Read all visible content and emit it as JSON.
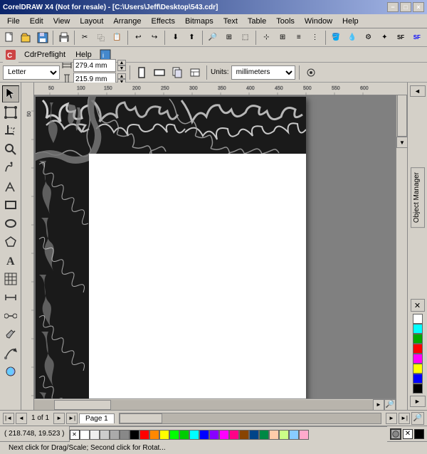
{
  "window": {
    "title": "CorelDRAW X4 (Not for resale) - [C:\\Users\\Jeff\\Desktop\\543.cdr]",
    "title_short": "CorelDRAW X4 (Not for resale) - [C:\\Users\\Jeff\\Desktop\\543.cdr]"
  },
  "title_buttons": {
    "minimize": "−",
    "maximize": "□",
    "close": "×",
    "inner_minimize": "−",
    "inner_maximize": "□",
    "inner_close": "×"
  },
  "menu": {
    "items": [
      "File",
      "Edit",
      "View",
      "Layout",
      "Arrange",
      "Effects",
      "Bitmaps",
      "Text",
      "Table",
      "Tools",
      "Window",
      "Help"
    ]
  },
  "toolbar2": {
    "preflight": "CdrPreflight",
    "help": "Help"
  },
  "prop_bar": {
    "width_label": "279.4 mm",
    "height_label": "215.9 mm",
    "units_label": "Units:",
    "units_value": "millimeters",
    "page_size": "Letter"
  },
  "tools": {
    "items": [
      "↖",
      "⊹",
      "✂",
      "↔",
      "⬚",
      "○",
      "✏",
      "A",
      "⊞",
      "🔎",
      "✋",
      "⬡",
      "▲",
      "⭕",
      "📐",
      "⌨",
      "🖊",
      "◈",
      "🔧",
      "◐"
    ]
  },
  "canvas": {
    "page_number": "1 of 1",
    "page_name": "Page 1"
  },
  "status": {
    "coords": "( 218.748, 19.523 )",
    "message": "Next click for Drag/Scale; Second click for Rotat..."
  },
  "right_panel": {
    "obj_manager": "Object Manager"
  },
  "colors": {
    "white": "#FFFFFF",
    "black": "#000000",
    "red": "#FF0000",
    "green": "#00AA00",
    "blue": "#0000FF",
    "cyan": "#00FFFF",
    "magenta": "#FF00FF",
    "yellow": "#FFFF00",
    "swatches": [
      "#FFFFFF",
      "#000000",
      "#AAAAAA",
      "#FF0000",
      "#00CC00",
      "#0000FF",
      "#FFFF00",
      "#FF00FF",
      "#00FFFF",
      "#FF8800",
      "#8800FF",
      "#0088FF",
      "#FF0088",
      "#88FF00",
      "#00FF88",
      "#884400",
      "#004488",
      "#FF4444",
      "#44FF44",
      "#4444FF",
      "#FF8844",
      "#44FFFF",
      "#FF44FF"
    ]
  }
}
